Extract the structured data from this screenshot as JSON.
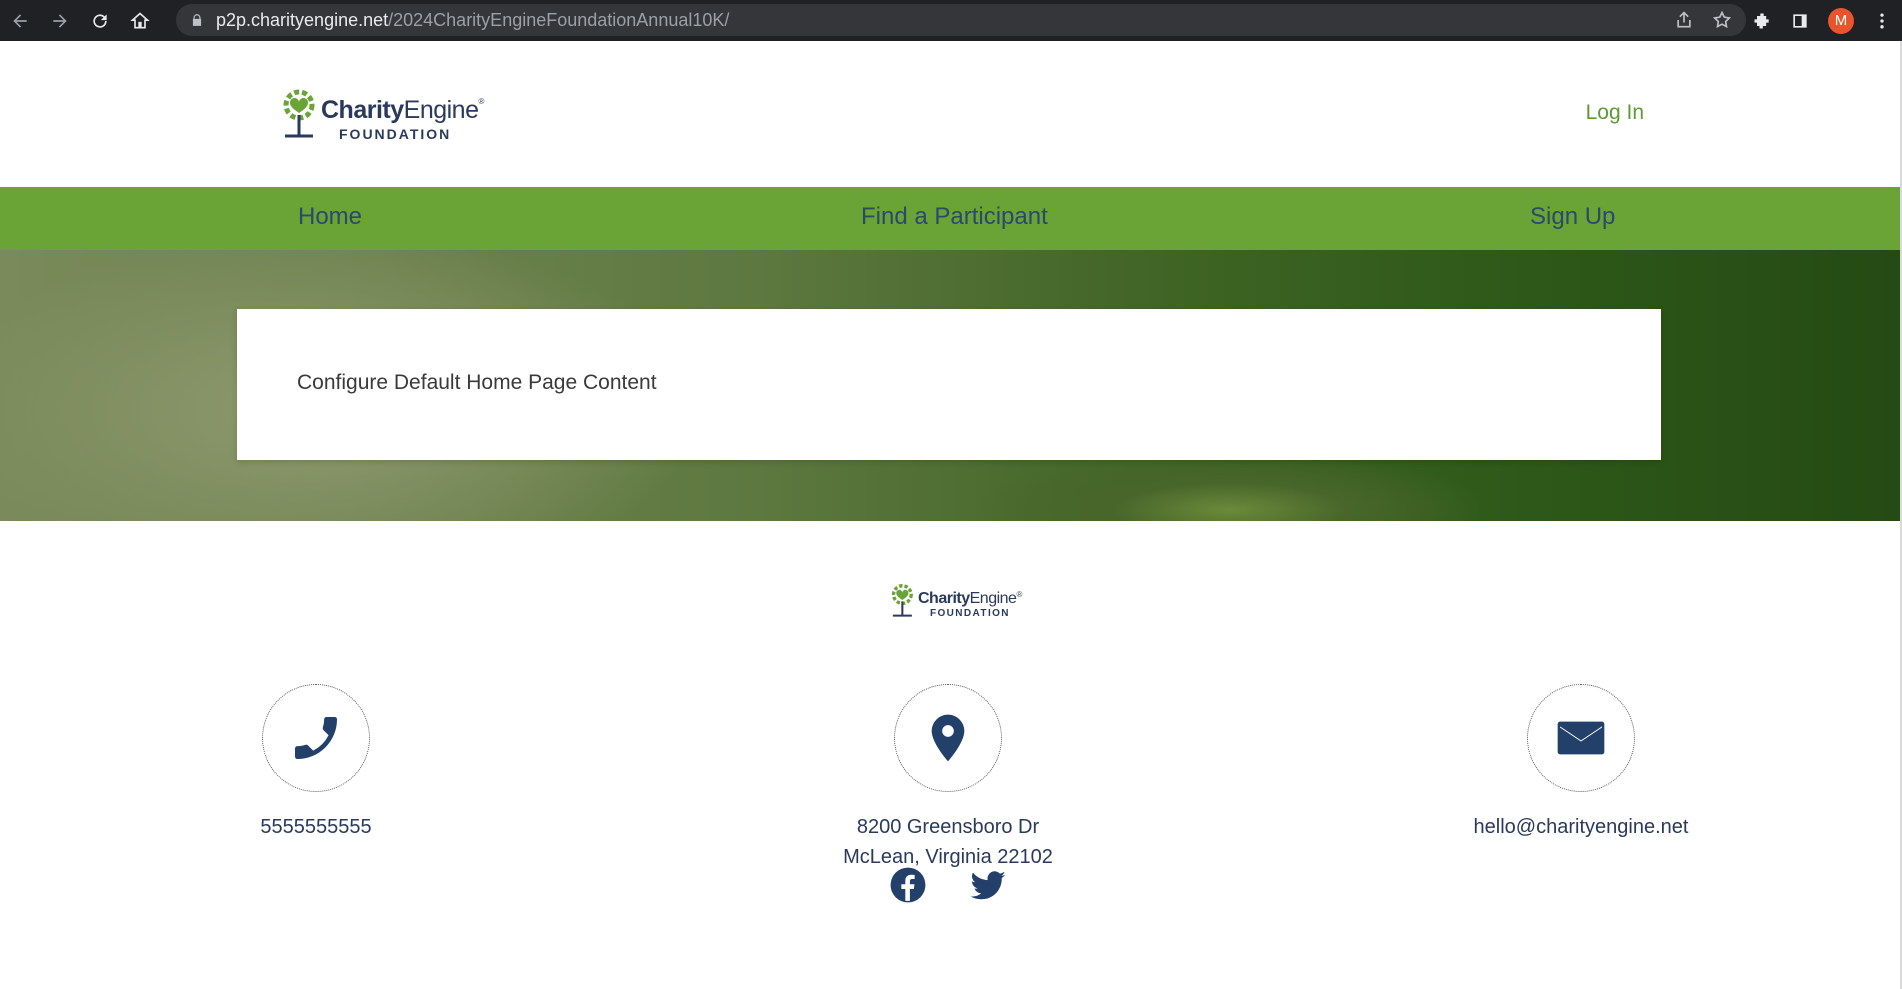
{
  "browser": {
    "url_host": "p2p.charityengine.net",
    "url_path": "/2024CharityEngineFoundationAnnual10K/",
    "avatar_letter": "M"
  },
  "header": {
    "logo_name_bold": "Charity",
    "logo_name_rest": "Engine",
    "logo_registered": "®",
    "logo_sub": "FOUNDATION",
    "login_label": "Log In"
  },
  "nav": {
    "home": "Home",
    "find": "Find a Participant",
    "signup": "Sign Up"
  },
  "hero": {
    "text": "Configure Default Home Page Content"
  },
  "footer": {
    "phone": "5555555555",
    "address_line1": "8200 Greensboro Dr",
    "address_line2": "McLean, Virginia 22102",
    "email": "hello@charityengine.net"
  },
  "colors": {
    "brand_green": "#6aa336",
    "brand_navy": "#22406a"
  }
}
